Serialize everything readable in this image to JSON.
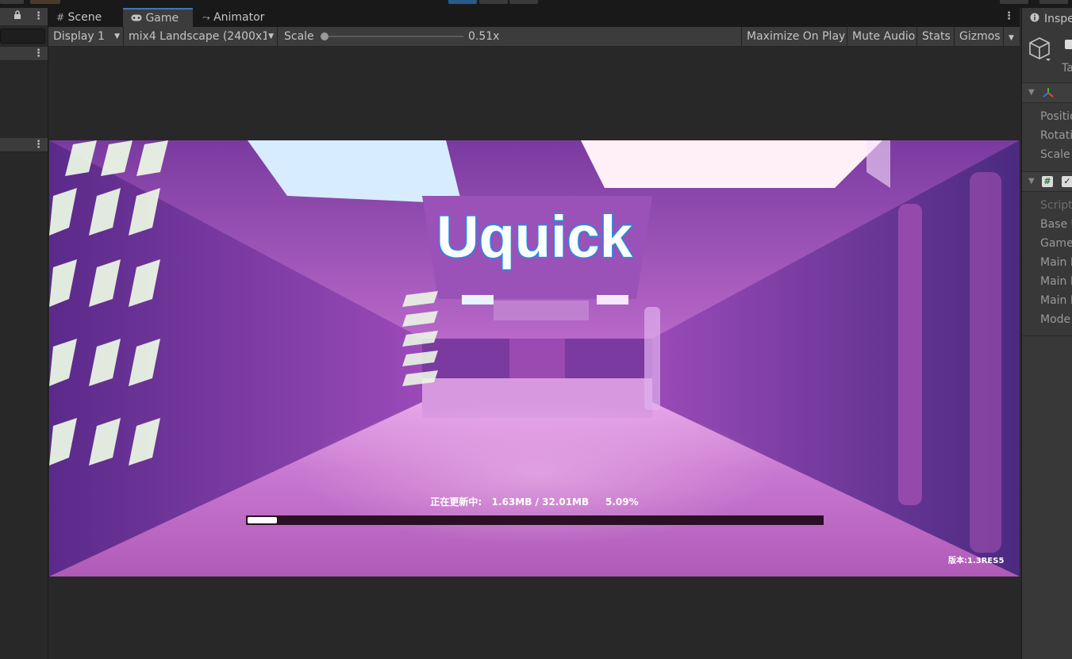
{
  "game_tabs": {
    "scene": "Scene",
    "game": "Game",
    "animator": "Animator"
  },
  "toolbar": {
    "display": "Display 1",
    "resolution": "mix4 Landscape (2400x1",
    "scale_label": "Scale",
    "scale_value": "0.51x",
    "scale_level": 0.0,
    "maximize_on_play": "Maximize On Play",
    "mute_audio": "Mute Audio",
    "stats": "Stats",
    "gizmos": "Gizmos"
  },
  "game_screen": {
    "logo_text": "Uquick",
    "update_status": "正在更新中:   1.63MB / 32.01MB     5.09%",
    "progress": 0.0509,
    "version": "版本:1.3RES5"
  },
  "inspector": {
    "tab_title": "Inspe",
    "tag_label": "Ta",
    "transform_fields": [
      "Positio",
      "Rotatio",
      "Scale"
    ],
    "script_fields": [
      "Script",
      "Base U",
      "Game",
      "Main P",
      "Main P",
      "Main P",
      "Mode"
    ]
  },
  "colors": {
    "editor_bg": "#282828",
    "toolbar_bg": "#3c3c3c",
    "tab_accent": "#3a79bb",
    "progress_fill": "#ffffff",
    "progress_track": "#2a0f25",
    "logo_fill": "#ffffff",
    "logo_outline": "#1a8fe6"
  },
  "icons": [
    "lock-icon",
    "kebab-icon",
    "grid-icon",
    "gamepad-icon",
    "animator-icon",
    "dropdown-icon",
    "info-icon",
    "cube-icon",
    "transform-icon",
    "script-icon",
    "checkbox-icon"
  ]
}
